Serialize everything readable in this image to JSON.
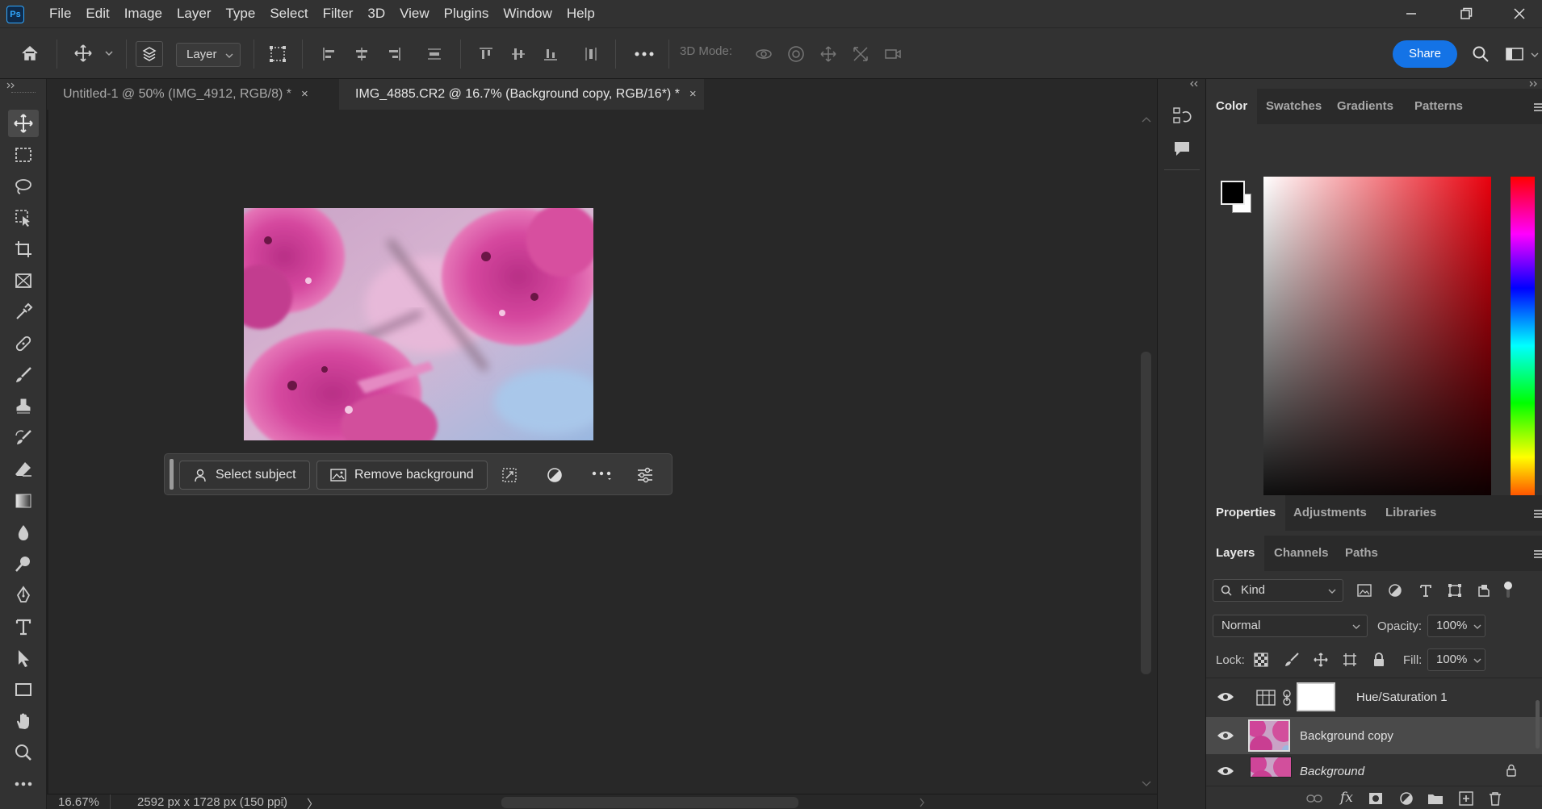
{
  "app": {
    "logo_text": "Ps"
  },
  "menu": [
    "File",
    "Edit",
    "Image",
    "Layer",
    "Type",
    "Select",
    "Filter",
    "3D",
    "View",
    "Plugins",
    "Window",
    "Help"
  ],
  "options": {
    "layer_select": "Layer",
    "mode_label": "3D Mode:",
    "share_label": "Share"
  },
  "tabs": [
    {
      "label": "Untitled-1 @ 50% (IMG_4912, RGB/8) *",
      "active": false
    },
    {
      "label": "IMG_4885.CR2 @ 16.7% (Background copy, RGB/16*) *",
      "active": true
    }
  ],
  "tab_close": "×",
  "taskbar": {
    "select_subject": "Select subject",
    "remove_background": "Remove background"
  },
  "status": {
    "zoom": "16.67%",
    "doc_info": "2592 px x 1728 px (150 ppi)",
    "arrow": "〉"
  },
  "color_panel": {
    "tabs": [
      "Color",
      "Swatches",
      "Gradients",
      "Patterns"
    ],
    "foreground": "#000000",
    "background": "#ffffff"
  },
  "properties_panel": {
    "tabs": [
      "Properties",
      "Adjustments",
      "Libraries"
    ]
  },
  "layers_panel": {
    "tabs": [
      "Layers",
      "Channels",
      "Paths"
    ],
    "kind_label": "Kind",
    "blend_mode": "Normal",
    "opacity_label": "Opacity:",
    "opacity_value": "100%",
    "lock_label": "Lock:",
    "fill_label": "Fill:",
    "fill_value": "100%",
    "layers": [
      {
        "name": "Hue/Saturation 1",
        "type": "adjustment",
        "selected": false
      },
      {
        "name": "Background copy",
        "type": "image",
        "selected": true
      },
      {
        "name": "Background",
        "type": "image",
        "selected": false,
        "locked": true
      }
    ],
    "fx_label": "fx"
  },
  "colors": {
    "accent": "#1473e6",
    "panel": "#323232",
    "canvas": "#282828"
  }
}
